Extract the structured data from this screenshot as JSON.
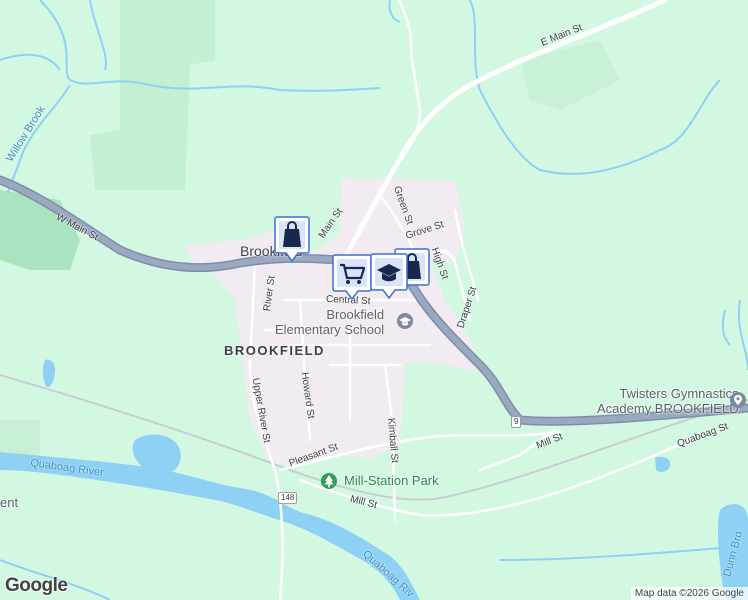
{
  "map": {
    "brand": "Google",
    "attribution": "Map data ©2026 Google",
    "colors": {
      "land": "#d3f8e2",
      "forest": "#c0ecd1",
      "urban": "#f2ebf1",
      "water": "#8ed1f5",
      "highway": "#8c9bb4",
      "local_road": "#ffffff"
    },
    "town": "BROOKFIELD",
    "place": "Brookfield",
    "roads": {
      "e_main": "E Main St",
      "w_main": "W Main St",
      "main": "Main St",
      "green": "Green St",
      "grove": "Grove St",
      "high": "High St",
      "draper": "Draper St",
      "central": "Central St",
      "river": "River St",
      "upper_river": "Upper River St",
      "howard": "Howard St",
      "pleasant": "Pleasant St",
      "kimball": "Kimball St",
      "mill_lower": "Mill St",
      "mill_right": "Mill St",
      "quaboag_st": "Quaboag St"
    },
    "waters": {
      "willow": "Willow Brook",
      "river_left": "Quaboag River",
      "river_bottom": "Quaboag Riv",
      "dunn": "Dunn Bro"
    },
    "pois": {
      "school_line1": "Brookfield",
      "school_line2": "Elementary School",
      "park": "Mill-Station Park",
      "gym_line1": "Twisters Gymnastics",
      "gym_line2": "Academy BROOKFIELD",
      "partial_left": "ent"
    },
    "shields": {
      "route9": "9",
      "route148": "148"
    },
    "markers": [
      {
        "icon": "shopping-bag-icon"
      },
      {
        "icon": "shopping-cart-icon"
      },
      {
        "icon": "school-icon"
      },
      {
        "icon": "shopping-bag-icon"
      }
    ]
  }
}
